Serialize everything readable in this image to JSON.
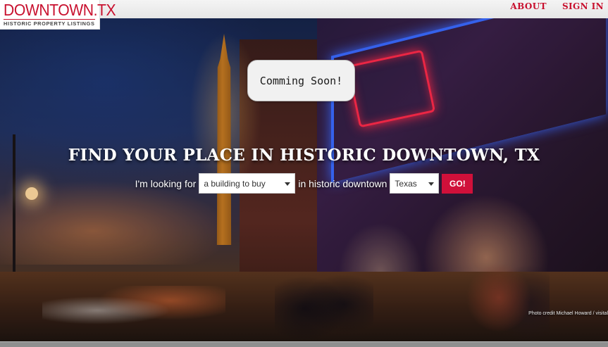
{
  "logo": {
    "title": "DOWNTOWN.TX",
    "subtitle": "HISTORIC PROPERTY LISTINGS"
  },
  "nav": {
    "about": "ABOUT",
    "sign_in": "SIGN IN"
  },
  "popup": {
    "text": "Comming Soon!"
  },
  "hero": {
    "headline": "FIND YOUR PLACE IN HISTORIC DOWNTOWN, TX",
    "search": {
      "prefix_label": "I'm looking for",
      "type_value": "a building to buy",
      "middle_label": "in historic downtown",
      "state_value": "Texas",
      "go_label": "GO!"
    },
    "photo_credit": "Photo credit Michael Howard / visital"
  },
  "colors": {
    "brand_red": "#c8102e",
    "go_button": "#d0103a"
  }
}
